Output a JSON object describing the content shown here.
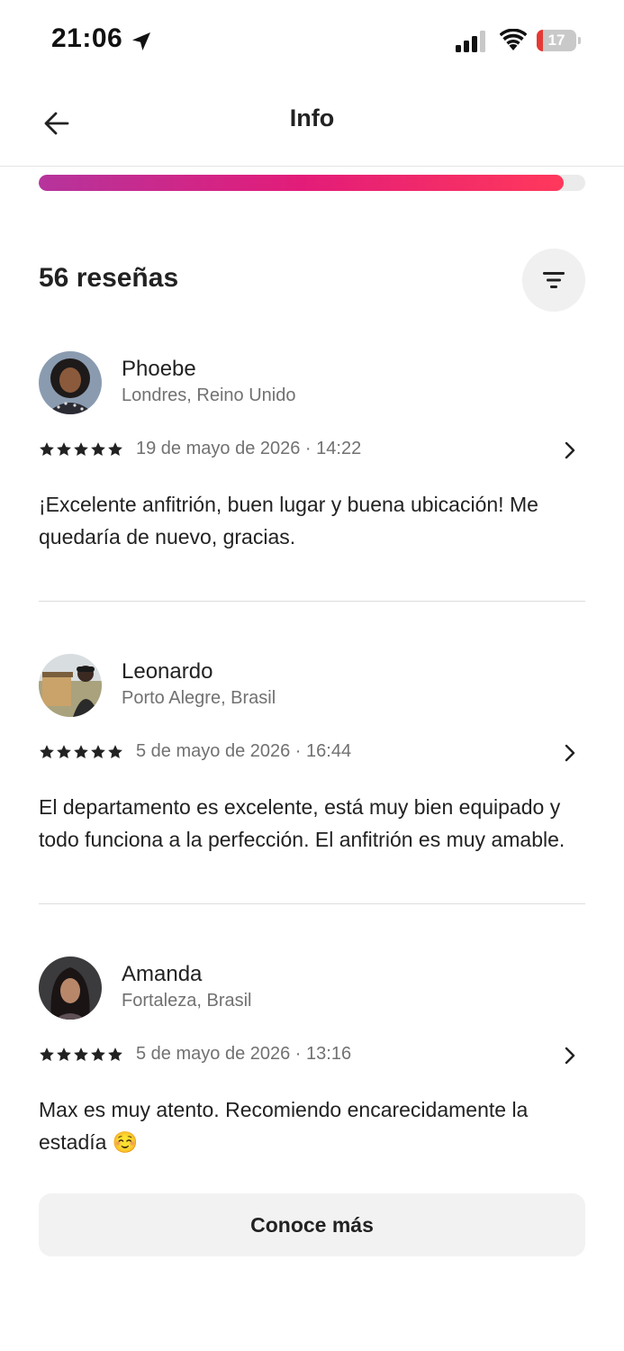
{
  "status_bar": {
    "time": "21:06",
    "battery_level": "17",
    "battery_fraction": 0.17
  },
  "header": {
    "title": "Info"
  },
  "rating_bar": {
    "fill_fraction": 0.96,
    "colors": [
      "#b5349c",
      "#e31c79",
      "#ff385c"
    ]
  },
  "reviews_section": {
    "count_label": "56 reseñas"
  },
  "reviews": [
    {
      "name": "Phoebe",
      "location": "Londres, Reino Unido",
      "stars": 5,
      "date": "19 de mayo de 2026 · 14:22",
      "text": "¡Excelente anfitrión, buen lugar y buena ubicación! Me quedaría de nuevo, gracias."
    },
    {
      "name": "Leonardo",
      "location": "Porto Alegre, Brasil",
      "stars": 5,
      "date": "5 de mayo de 2026 · 16:44",
      "text": "El departamento es excelente, está muy bien equipado y todo funciona a la perfección. El anfitrión es muy amable."
    },
    {
      "name": "Amanda",
      "location": "Fortaleza, Brasil",
      "stars": 5,
      "date": "5 de mayo de 2026 · 13:16",
      "text": "Max es muy atento. Recomiendo encarecidamente la estadía ☺️"
    }
  ],
  "actions": {
    "more_label": "Conoce más"
  },
  "colors": {
    "accent": "#ff385c",
    "text_primary": "#222222",
    "text_secondary": "#717171",
    "battery_low": "#e53935"
  }
}
